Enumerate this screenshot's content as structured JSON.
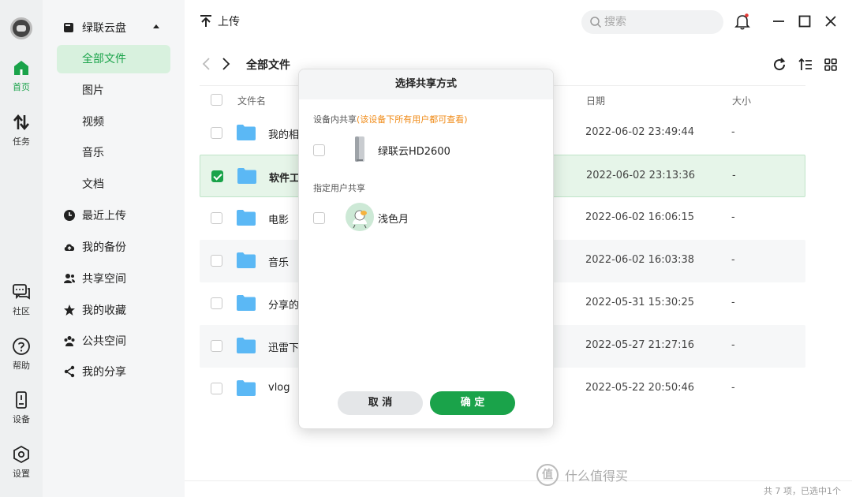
{
  "rail": {
    "items": [
      {
        "label": "首页"
      },
      {
        "label": "任务"
      },
      {
        "label": "社区"
      },
      {
        "label": "帮助"
      },
      {
        "label": "设备"
      },
      {
        "label": "设置"
      }
    ]
  },
  "sidebar": {
    "cloud_label": "绿联云盘",
    "sub_items": [
      {
        "label": "全部文件"
      },
      {
        "label": "图片"
      },
      {
        "label": "视频"
      },
      {
        "label": "音乐"
      },
      {
        "label": "文档"
      }
    ],
    "items": [
      {
        "label": "最近上传",
        "icon": "clock-icon"
      },
      {
        "label": "我的备份",
        "icon": "cloud-upload-icon"
      },
      {
        "label": "共享空间",
        "icon": "users-icon"
      },
      {
        "label": "我的收藏",
        "icon": "star-icon"
      },
      {
        "label": "公共空间",
        "icon": "group-icon"
      },
      {
        "label": "我的分享",
        "icon": "share-icon"
      }
    ]
  },
  "toolbar": {
    "upload_label": "上传",
    "search_placeholder": "搜索"
  },
  "breadcrumb": {
    "title": "全部文件"
  },
  "table": {
    "headers": {
      "name": "文件名",
      "date": "日期",
      "size": "大小"
    },
    "rows": [
      {
        "name": "我的相",
        "date": "2022-06-02 23:49:44",
        "size": "-",
        "checked": false
      },
      {
        "name": "软件工",
        "date": "2022-06-02 23:13:36",
        "size": "-",
        "checked": true
      },
      {
        "name": "电影",
        "date": "2022-06-02 16:06:15",
        "size": "-",
        "checked": false
      },
      {
        "name": "音乐",
        "date": "2022-06-02 16:03:38",
        "size": "-",
        "checked": false
      },
      {
        "name": "分享的",
        "date": "2022-05-31 15:30:25",
        "size": "-",
        "checked": false
      },
      {
        "name": "迅雷下",
        "date": "2022-05-27 21:27:16",
        "size": "-",
        "checked": false
      },
      {
        "name": "vlog",
        "date": "2022-05-22 20:50:46",
        "size": "-",
        "checked": false
      }
    ],
    "count_text": "共 7 项，已选中1个"
  },
  "modal": {
    "title": "选择共享方式",
    "device_section_label": "设备内共享",
    "device_section_hint": "(该设备下所有用户都可查看)",
    "device_name": "绿联云HD2600",
    "user_section_label": "指定用户共享",
    "user_name": "浅色月",
    "cancel_label": "取 消",
    "ok_label": "确 定"
  },
  "watermark": {
    "icon_text": "值",
    "text": "什么值得买"
  },
  "colors": {
    "accent": "#1aa34a",
    "hint": "#f08c1a",
    "folder": "#5bb8f5",
    "notify_dot": "#e53935"
  }
}
